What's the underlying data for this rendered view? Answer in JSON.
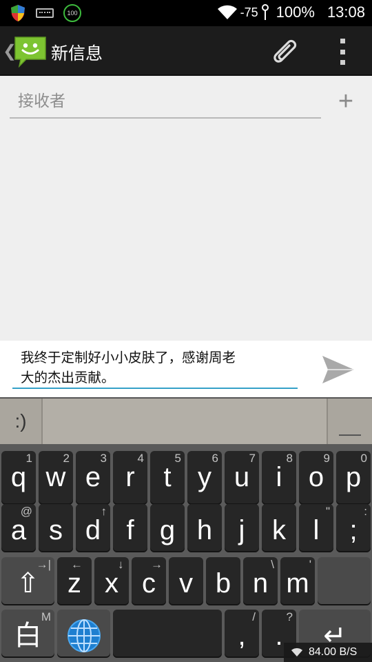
{
  "status_bar": {
    "signal_strength": "-75",
    "battery_percent": "100%",
    "time": "13:08",
    "notif_badge": "100",
    "icons": [
      "shield-icon",
      "keyboard-icon",
      "circle-100-icon",
      "wifi-icon",
      "signal-icon"
    ]
  },
  "action_bar": {
    "back_glyph": "❮",
    "title": "新信息",
    "icons": [
      "messaging-app-icon",
      "paperclip-icon",
      "overflow-menu-icon"
    ]
  },
  "recipient": {
    "placeholder": "接收者",
    "add_glyph": "+"
  },
  "compose": {
    "text_line1": "我终于定制好小小皮肤了，感谢周老",
    "text_line2": "大的杰出贡献。"
  },
  "candidate_bar": {
    "emoji_label": ":)"
  },
  "keyboard": {
    "row1": [
      {
        "label": "q",
        "hint": "1"
      },
      {
        "label": "w",
        "hint": "2"
      },
      {
        "label": "e",
        "hint": "3"
      },
      {
        "label": "r",
        "hint": "4"
      },
      {
        "label": "t",
        "hint": "5"
      },
      {
        "label": "y",
        "hint": "6"
      },
      {
        "label": "u",
        "hint": "7"
      },
      {
        "label": "i",
        "hint": "8"
      },
      {
        "label": "o",
        "hint": "9"
      },
      {
        "label": "p",
        "hint": "0"
      }
    ],
    "row2": [
      {
        "label": "a",
        "hint": "@"
      },
      {
        "label": "s",
        "hint": ""
      },
      {
        "label": "d",
        "hint": "↑"
      },
      {
        "label": "f",
        "hint": ""
      },
      {
        "label": "g",
        "hint": ""
      },
      {
        "label": "h",
        "hint": ""
      },
      {
        "label": "j",
        "hint": ""
      },
      {
        "label": "k",
        "hint": ""
      },
      {
        "label": "l",
        "hint": "\""
      },
      {
        "label": ";",
        "hint": ":"
      }
    ],
    "row3": [
      {
        "label": "z",
        "hint": "←"
      },
      {
        "label": "x",
        "hint": "↓"
      },
      {
        "label": "c",
        "hint": "→"
      },
      {
        "label": "v",
        "hint": ""
      },
      {
        "label": "b",
        "hint": ""
      },
      {
        "label": "n",
        "hint": "\\"
      },
      {
        "label": "m",
        "hint": "'"
      }
    ],
    "shift": {
      "label": "⇧",
      "hint": "→|"
    },
    "mode": {
      "label": "白",
      "hint": "M"
    },
    "comma": {
      "label": ",",
      "hint": "/"
    },
    "period": {
      "label": ".",
      "hint": "?"
    },
    "enter_glyph": "↵"
  },
  "net_overlay": {
    "speed": "84.00 B/S"
  },
  "colors": {
    "accent": "#33a0c8",
    "app_green": "#7dc431",
    "key_bg": "#262626",
    "keyboard_bg": "#5a5a5a"
  }
}
